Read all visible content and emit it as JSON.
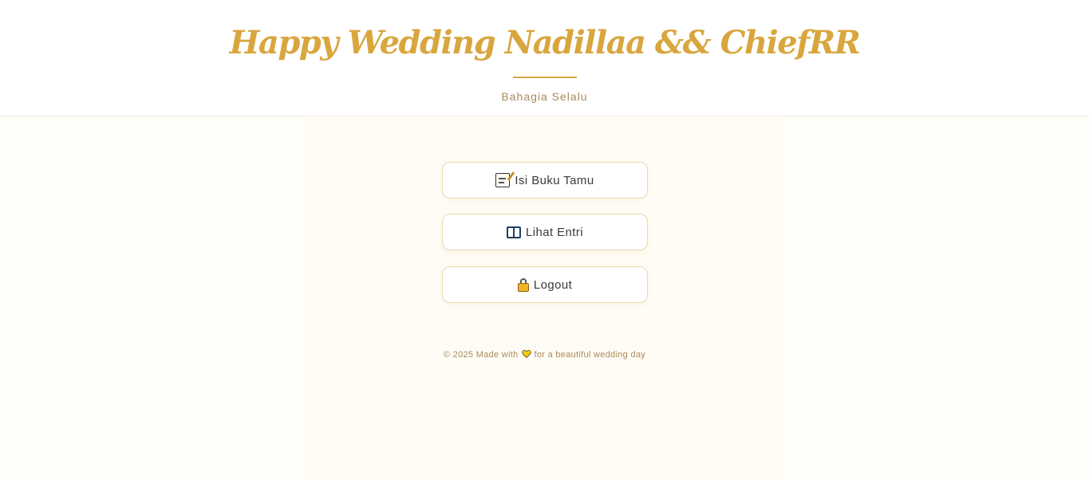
{
  "header": {
    "title": "Happy Wedding Nadillaa && ChiefRR",
    "subtitle": "Bahagia Selalu"
  },
  "menu": {
    "items": [
      {
        "label": "Isi Buku Tamu",
        "icon": "memo-icon"
      },
      {
        "label": "Lihat Entri",
        "icon": "book-icon"
      },
      {
        "label": "Logout",
        "icon": "lock-icon"
      }
    ]
  },
  "footer": {
    "prefix": "© 2025 Made with",
    "icon": "heart-icon",
    "suffix": "for a beautiful wedding day"
  },
  "colors": {
    "accent": "#d9a63e",
    "background": "#fffdf8",
    "text_muted": "#a98a5c",
    "heart": "#f5d000"
  }
}
